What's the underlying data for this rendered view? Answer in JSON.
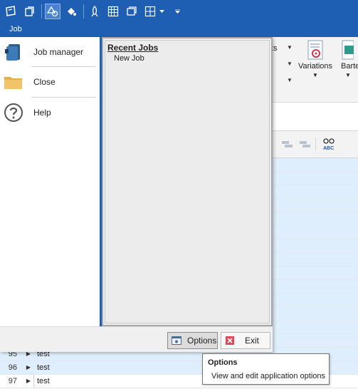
{
  "quick_access": {
    "icons": [
      "app-menu-icon",
      "save-icon",
      "shapes-icon",
      "paint-bucket-icon",
      "rocket-icon",
      "grid-table-icon",
      "window-icon",
      "table-dropdown-icon",
      "customize-dropdown-icon"
    ]
  },
  "tabs": {
    "active": "Job"
  },
  "backstage": {
    "items": [
      {
        "label": "Job manager",
        "icon": "job-manager-icon"
      },
      {
        "label": "Close",
        "icon": "folder-icon"
      },
      {
        "label": "Help",
        "icon": "help-icon"
      }
    ],
    "recent": {
      "title": "Recent Jobs",
      "items": [
        "New Job"
      ]
    },
    "footer": {
      "options_label": "Options",
      "exit_label": "Exit"
    }
  },
  "ribbon": {
    "fragment_label": "ts",
    "variations_label": "Variations",
    "barte_label": "Barte"
  },
  "grid": {
    "rows": [
      {
        "num": "95",
        "value": "test"
      },
      {
        "num": "96",
        "value": "test"
      },
      {
        "num": "97",
        "value": "test"
      }
    ]
  },
  "tooltip": {
    "title": "Options",
    "description": "View and edit application options"
  },
  "colors": {
    "accent": "#1f5fb3",
    "row_alt": "#dfeefc"
  }
}
